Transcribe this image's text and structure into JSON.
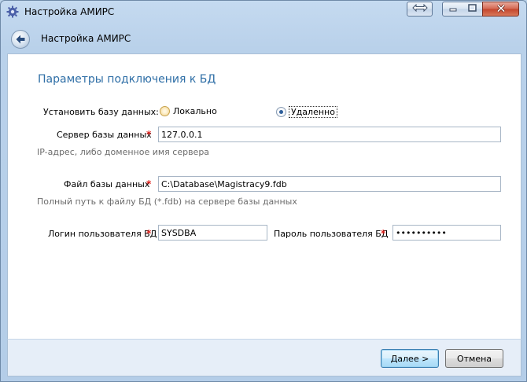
{
  "window": {
    "title": "Настройка АМИРС",
    "icon": "gear-icon"
  },
  "nav": {
    "title": "Настройка АМИРС",
    "back_icon": "back-arrow-icon"
  },
  "form": {
    "heading": "Параметры подключения к БД",
    "install_label": "Установить базу данных:",
    "install_options": [
      {
        "label": "Локально",
        "selected": false
      },
      {
        "label": "Удаленно",
        "selected": true
      }
    ],
    "server_label": "Сервер базы данных",
    "server_value": "127.0.0.1",
    "server_hint": "IP-адрес, либо доменное имя сервера",
    "file_label": "Файл базы данных",
    "file_value": "C:\\Database\\Magistracy9.fdb",
    "file_hint": "Полный путь к файлу БД (*.fdb) на сервере базы данных",
    "login_label": "Логин пользователя БД",
    "login_value": "SYSDBA",
    "password_label": "Пароль пользователя БД",
    "password_value": "••••••••••",
    "required_mark": "*"
  },
  "footer": {
    "next_label": "Далее >",
    "cancel_label": "Отмена"
  },
  "colors": {
    "heading": "#2e6ea6",
    "required": "#e0201b",
    "hint": "#6d6d6d"
  }
}
